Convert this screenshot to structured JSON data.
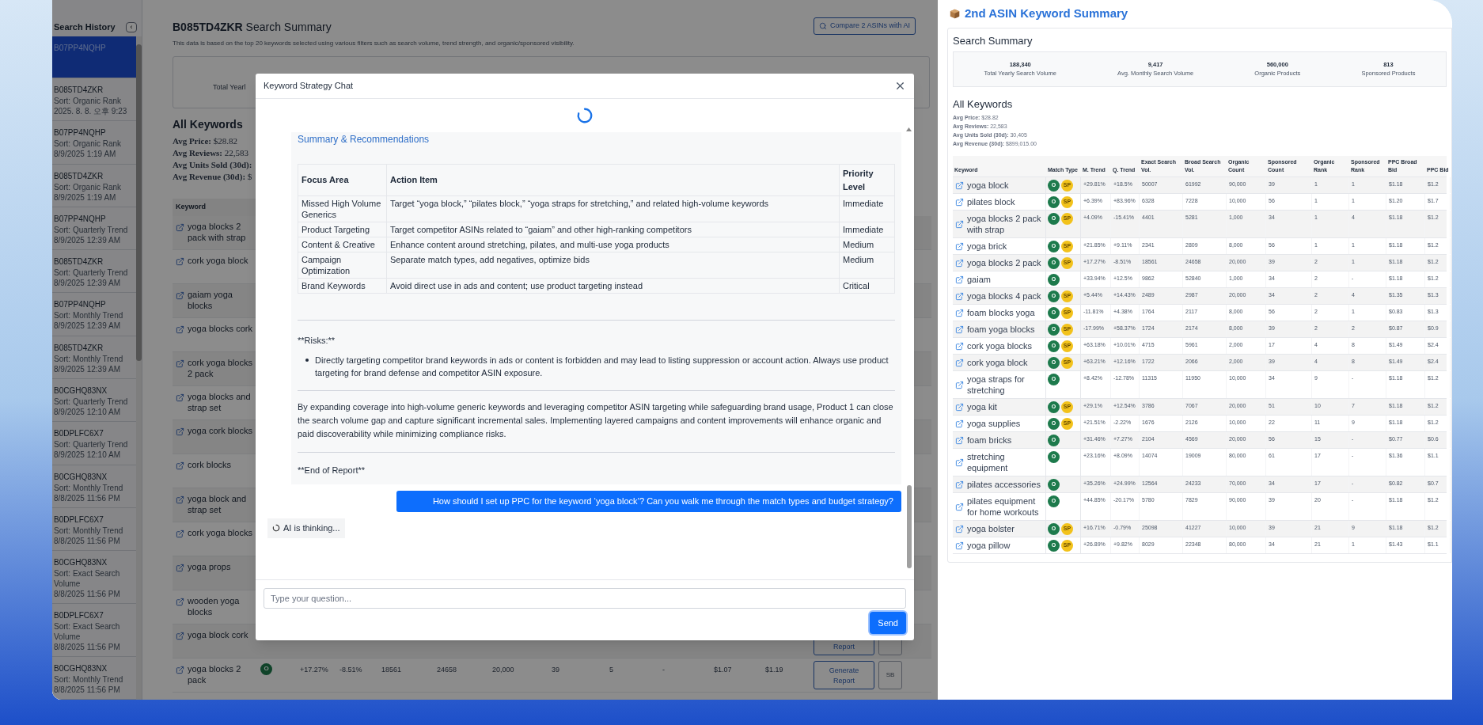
{
  "sidebar": {
    "title": "Search History",
    "collapse_label": "‹",
    "items": [
      {
        "asin": "B07PP4NQHP",
        "selected": true
      },
      {
        "asin": "B085TD4ZKR",
        "sort": "Sort: Organic Rank",
        "time": "2025. 8. 8. 오후 9:23",
        "selected": false
      },
      {
        "asin": "B07PP4NQHP",
        "sort": "Sort: Organic Rank",
        "time": "8/9/2025 1:19 AM",
        "selected": false
      },
      {
        "asin": "B085TD4ZKR",
        "sort": "Sort: Organic Rank",
        "time": "8/9/2025 1:19 AM",
        "selected": false
      },
      {
        "asin": "B07PP4NQHP",
        "sort": "Sort: Quarterly Trend",
        "time": "8/9/2025 12:39 AM",
        "selected": false
      },
      {
        "asin": "B085TD4ZKR",
        "sort": "Sort: Quarterly Trend",
        "time": "8/9/2025 12:39 AM",
        "selected": false
      },
      {
        "asin": "B07PP4NQHP",
        "sort": "Sort: Monthly Trend",
        "time": "8/9/2025 12:39 AM",
        "selected": false
      },
      {
        "asin": "B085TD4ZKR",
        "sort": "Sort: Monthly Trend",
        "time": "8/9/2025 12:39 AM",
        "selected": false
      },
      {
        "asin": "B0CGHQ83NX",
        "sort": "Sort: Quarterly Trend",
        "time": "8/9/2025 12:10 AM",
        "selected": false
      },
      {
        "asin": "B0DPLFC6X7",
        "sort": "Sort: Quarterly Trend",
        "time": "8/9/2025 12:10 AM",
        "selected": false
      },
      {
        "asin": "B0CGHQ83NX",
        "sort": "Sort: Monthly Trend",
        "time": "8/8/2025 11:56 PM",
        "selected": false
      },
      {
        "asin": "B0DPLFC6X7",
        "sort": "Sort: Monthly Trend",
        "time": "8/8/2025 11:56 PM",
        "selected": false
      },
      {
        "asin": "B0CGHQ83NX",
        "sort": "Sort: Exact Search Volume",
        "time": "8/8/2025 11:56 PM",
        "selected": false
      },
      {
        "asin": "B0DPLFC6X7",
        "sort": "Sort: Exact Search Volume",
        "time": "8/8/2025 11:56 PM",
        "selected": false
      },
      {
        "asin": "B0CGHQ83NX",
        "sort": "Sort: Monthly Trend",
        "time": "8/8/2025 11:56 PM",
        "selected": false
      }
    ]
  },
  "summary": {
    "title": "**B085TD4ZKR** Search Summary",
    "description": "This data is based on the top 20 keywords selected using various filters such as search volume, trend strength, and organic/sponsored visibility.",
    "compare_button": "Compare 2 ASINs with AI",
    "stat_label": "Total Yearl",
    "keywords_title": "All Keywords",
    "averages": [
      "**Avg Price:** $28.82",
      "**Avg Reviews:** 22,583",
      "**Avg Units Sold (30d):**",
      "**Avg Revenue (30d):** $"
    ],
    "table": {
      "column_1": "Keyword",
      "rows": [
        {
          "keyword": "yoga blocks 2 pack with strap"
        },
        {
          "keyword": "cork yoga block"
        },
        {
          "keyword": "gaiam yoga blocks"
        },
        {
          "keyword": "yoga blocks cork"
        },
        {
          "keyword": "cork yoga blocks 2 pack"
        },
        {
          "keyword": "yoga blocks and strap set"
        },
        {
          "keyword": "yoga cork blocks"
        },
        {
          "keyword": "cork blocks"
        },
        {
          "keyword": "yoga block and strap set"
        },
        {
          "keyword": "cork yoga blocks"
        },
        {
          "keyword": "yoga props"
        },
        {
          "keyword": "wooden yoga blocks"
        },
        {
          "keyword": "yoga block cork",
          "actions": [
            {
              "kind": "report",
              "label": "Report"
            },
            {
              "kind": "sb"
            }
          ]
        },
        {
          "keyword": "yoga blocks 2 pack",
          "match": [
            {
              "kind": "organic",
              "label": "O"
            }
          ],
          "cells": [
            "+17.27%",
            "-8.51%",
            "18561",
            "24658",
            "20,000",
            "39",
            "5",
            "-",
            "$1.07",
            "$1.19"
          ],
          "actions": [
            {
              "kind": "report",
              "label": "Generate Report"
            },
            {
              "kind": "sb",
              "label": "SB"
            }
          ]
        }
      ]
    }
  },
  "chat": {
    "title": "Keyword Strategy Chat",
    "loading": true,
    "ai_message": {
      "heading": "Summary & Recommendations",
      "table": {
        "columns": [
          "Focus Area",
          "Action Item",
          "Priority Level"
        ],
        "rows": [
          [
            "Missed High Volume Generics",
            "Target “yoga block,” “pilates block,” “yoga straps for stretching,” and related high-volume keywords",
            "Immediate"
          ],
          [
            "Product Targeting",
            "Target competitor ASINs related to “gaiam” and other high-ranking competitors",
            "Immediate"
          ],
          [
            "Content & Creative",
            "Enhance content around stretching, pilates, and multi-use yoga products",
            "Medium"
          ],
          [
            "Campaign Optimization",
            "Separate match types, add negatives, optimize bids",
            "Medium"
          ],
          [
            "Brand Keywords",
            "Avoid direct use in ads and content; use product targeting instead",
            "Critical"
          ]
        ]
      },
      "risks_label": "**Risks:**",
      "risks": [
        "Directly targeting competitor brand keywords in ads or content is forbidden and may lead to listing suppression or account action. Always use product targeting for brand defense and competitor ASIN exposure."
      ],
      "conclusion": "By expanding coverage into high-volume generic keywords and leveraging competitor ASIN targeting while safeguarding brand usage, Product 1 can close the search volume gap and capture significant incremental sales. Implementing layered campaigns and content improvements will enhance organic and paid discoverability while minimizing compliance risks.",
      "end": "**End of Report**"
    },
    "user_message": "How should I set up PPC for the keyword ‘yoga block’? Can you walk me through the match types and budget strategy?",
    "thinking": "AI is thinking...",
    "input_placeholder": "Type your question...",
    "send": "Send"
  },
  "second": {
    "title": "2nd ASIN Keyword Summary",
    "summary_title": "Search Summary",
    "stats": [
      {
        "value": "188,340",
        "label": "Total Yearly Search Volume"
      },
      {
        "value": "9,417",
        "label": "Avg. Monthly Search Volume"
      },
      {
        "value": "560,000",
        "label": "Organic Products"
      },
      {
        "value": "813",
        "label": "Sponsored Products"
      }
    ],
    "keywords_title": "All Keywords",
    "averages": [
      "**Avg Price:** $28.82",
      "**Avg Reviews:** 22,583",
      "**Avg Units Sold (30d):** 30,405",
      "**Avg Revenue (30d):** $899,015.00"
    ],
    "columns": [
      "Keyword",
      "Match Type",
      "M. Trend",
      "Q. Trend",
      "Exact Search Vol.",
      "Broad Search Vol.",
      "Organic Count",
      "Sponsored Count",
      "Organic Rank",
      "Sponsored Rank",
      "PPC Broad Bid",
      "PPC Bid"
    ],
    "rows": [
      {
        "keyword": "yoga block",
        "match_type": [
          {
            "kind": "organic",
            "label": "O"
          },
          {
            "kind": "sponsored",
            "label": "SP"
          }
        ],
        "m_trend": "+29.81%",
        "q_trend": "+18.5%",
        "exact_search_vol": "50007",
        "broad_search_vol": "61992",
        "organic_count": "90,000",
        "sponsored_count": "39",
        "organic_rank": "1",
        "sponsored_rank": "1",
        "ppc_broad_bid": "$1.18",
        "column_12": "$1.2"
      },
      {
        "keyword": "pilates block",
        "match_type": [
          {
            "kind": "organic",
            "label": "O"
          },
          {
            "kind": "sponsored",
            "label": "SP"
          }
        ],
        "m_trend": "+6.39%",
        "q_trend": "+83.96%",
        "exact_search_vol": "6328",
        "broad_search_vol": "7228",
        "organic_count": "10,000",
        "sponsored_count": "56",
        "organic_rank": "1",
        "sponsored_rank": "1",
        "ppc_broad_bid": "$1.20",
        "column_12": "$1.7"
      },
      {
        "keyword": "yoga blocks 2 pack with strap",
        "match_type": [
          {
            "kind": "organic",
            "label": "O"
          },
          {
            "kind": "sponsored",
            "label": "SP"
          }
        ],
        "m_trend": "+4.09%",
        "q_trend": "-15.41%",
        "exact_search_vol": "4401",
        "broad_search_vol": "5281",
        "organic_count": "1,000",
        "sponsored_count": "34",
        "organic_rank": "1",
        "sponsored_rank": "4",
        "ppc_broad_bid": "$1.18",
        "column_12": "$1.2"
      },
      {
        "keyword": "yoga brick",
        "match_type": [
          {
            "kind": "organic",
            "label": "O"
          },
          {
            "kind": "sponsored",
            "label": "SP"
          }
        ],
        "m_trend": "+21.85%",
        "q_trend": "+9.11%",
        "exact_search_vol": "2341",
        "broad_search_vol": "2809",
        "organic_count": "8,000",
        "sponsored_count": "56",
        "organic_rank": "1",
        "sponsored_rank": "1",
        "ppc_broad_bid": "$1.18",
        "column_12": "$1.2"
      },
      {
        "keyword": "yoga blocks 2 pack",
        "match_type": [
          {
            "kind": "organic",
            "label": "O"
          },
          {
            "kind": "sponsored",
            "label": "SP"
          }
        ],
        "m_trend": "+17.27%",
        "q_trend": "-8.51%",
        "exact_search_vol": "18561",
        "broad_search_vol": "24658",
        "organic_count": "20,000",
        "sponsored_count": "39",
        "organic_rank": "2",
        "sponsored_rank": "1",
        "ppc_broad_bid": "$1.18",
        "column_12": "$1.2"
      },
      {
        "keyword": "gaiam",
        "match_type": [
          {
            "kind": "organic",
            "label": "O"
          }
        ],
        "m_trend": "+33.94%",
        "q_trend": "+12.5%",
        "exact_search_vol": "9862",
        "broad_search_vol": "52840",
        "organic_count": "1,000",
        "sponsored_count": "34",
        "organic_rank": "2",
        "sponsored_rank": "-",
        "ppc_broad_bid": "$1.18",
        "column_12": "$1.2"
      },
      {
        "keyword": "yoga blocks 4 pack",
        "match_type": [
          {
            "kind": "organic",
            "label": "O"
          },
          {
            "kind": "sponsored",
            "label": "SP"
          }
        ],
        "m_trend": "+5.44%",
        "q_trend": "+14.43%",
        "exact_search_vol": "2489",
        "broad_search_vol": "2987",
        "organic_count": "20,000",
        "sponsored_count": "34",
        "organic_rank": "2",
        "sponsored_rank": "4",
        "ppc_broad_bid": "$1.35",
        "column_12": "$1.3"
      },
      {
        "keyword": "foam blocks yoga",
        "match_type": [
          {
            "kind": "organic",
            "label": "O"
          },
          {
            "kind": "sponsored",
            "label": "SP"
          }
        ],
        "m_trend": "-11.81%",
        "q_trend": "+4.38%",
        "exact_search_vol": "1764",
        "broad_search_vol": "2117",
        "organic_count": "8,000",
        "sponsored_count": "56",
        "organic_rank": "2",
        "sponsored_rank": "1",
        "ppc_broad_bid": "$0.83",
        "column_12": "$1.3"
      },
      {
        "keyword": "foam yoga blocks",
        "match_type": [
          {
            "kind": "organic",
            "label": "O"
          },
          {
            "kind": "sponsored",
            "label": "SP"
          }
        ],
        "m_trend": "-17.99%",
        "q_trend": "+58.37%",
        "exact_search_vol": "1724",
        "broad_search_vol": "2174",
        "organic_count": "8,000",
        "sponsored_count": "39",
        "organic_rank": "2",
        "sponsored_rank": "2",
        "ppc_broad_bid": "$0.87",
        "column_12": "$0.9"
      },
      {
        "keyword": "cork yoga blocks",
        "match_type": [
          {
            "kind": "organic",
            "label": "O"
          },
          {
            "kind": "sponsored",
            "label": "SP"
          }
        ],
        "m_trend": "+63.18%",
        "q_trend": "+10.01%",
        "exact_search_vol": "4715",
        "broad_search_vol": "5961",
        "organic_count": "2,000",
        "sponsored_count": "17",
        "organic_rank": "4",
        "sponsored_rank": "8",
        "ppc_broad_bid": "$1.49",
        "column_12": "$2.4"
      },
      {
        "keyword": "cork yoga block",
        "match_type": [
          {
            "kind": "organic",
            "label": "O"
          },
          {
            "kind": "sponsored",
            "label": "SP"
          }
        ],
        "m_trend": "+63.21%",
        "q_trend": "+12.16%",
        "exact_search_vol": "1722",
        "broad_search_vol": "2066",
        "organic_count": "2,000",
        "sponsored_count": "39",
        "organic_rank": "4",
        "sponsored_rank": "8",
        "ppc_broad_bid": "$1.49",
        "column_12": "$2.4"
      },
      {
        "keyword": "yoga straps for stretching",
        "match_type": [
          {
            "kind": "organic",
            "label": "O"
          }
        ],
        "m_trend": "+8.42%",
        "q_trend": "-12.78%",
        "exact_search_vol": "11315",
        "broad_search_vol": "11950",
        "organic_count": "10,000",
        "sponsored_count": "34",
        "organic_rank": "9",
        "sponsored_rank": "-",
        "ppc_broad_bid": "$1.18",
        "column_12": "$1.2"
      },
      {
        "keyword": "yoga kit",
        "match_type": [
          {
            "kind": "organic",
            "label": "O"
          },
          {
            "kind": "sponsored",
            "label": "SP"
          }
        ],
        "m_trend": "+29.1%",
        "q_trend": "+12.54%",
        "exact_search_vol": "3786",
        "broad_search_vol": "7067",
        "organic_count": "20,000",
        "sponsored_count": "51",
        "organic_rank": "10",
        "sponsored_rank": "7",
        "ppc_broad_bid": "$1.18",
        "column_12": "$1.2"
      },
      {
        "keyword": "yoga supplies",
        "match_type": [
          {
            "kind": "organic",
            "label": "O"
          },
          {
            "kind": "sponsored",
            "label": "SP"
          }
        ],
        "m_trend": "+21.51%",
        "q_trend": "-2.22%",
        "exact_search_vol": "1676",
        "broad_search_vol": "2126",
        "organic_count": "10,000",
        "sponsored_count": "22",
        "organic_rank": "11",
        "sponsored_rank": "9",
        "ppc_broad_bid": "$1.18",
        "column_12": "$1.2"
      },
      {
        "keyword": "foam bricks",
        "match_type": [
          {
            "kind": "organic",
            "label": "O"
          }
        ],
        "m_trend": "+31.46%",
        "q_trend": "+7.27%",
        "exact_search_vol": "2104",
        "broad_search_vol": "4569",
        "organic_count": "20,000",
        "sponsored_count": "56",
        "organic_rank": "15",
        "sponsored_rank": "-",
        "ppc_broad_bid": "$0.77",
        "column_12": "$0.6"
      },
      {
        "keyword": "stretching equipment",
        "match_type": [
          {
            "kind": "organic",
            "label": "O"
          }
        ],
        "m_trend": "+23.16%",
        "q_trend": "+8.09%",
        "exact_search_vol": "14074",
        "broad_search_vol": "19009",
        "organic_count": "80,000",
        "sponsored_count": "61",
        "organic_rank": "17",
        "sponsored_rank": "-",
        "ppc_broad_bid": "$1.36",
        "column_12": "$1.1"
      },
      {
        "keyword": "pilates accessories",
        "match_type": [
          {
            "kind": "organic",
            "label": "O"
          }
        ],
        "m_trend": "+35.26%",
        "q_trend": "+24.99%",
        "exact_search_vol": "12564",
        "broad_search_vol": "24233",
        "organic_count": "70,000",
        "sponsored_count": "34",
        "organic_rank": "17",
        "sponsored_rank": "-",
        "ppc_broad_bid": "$0.82",
        "column_12": "$0.7"
      },
      {
        "keyword": "pilates equipment for home workouts",
        "match_type": [
          {
            "kind": "organic",
            "label": "O"
          }
        ],
        "m_trend": "+44.85%",
        "q_trend": "-20.17%",
        "exact_search_vol": "5780",
        "broad_search_vol": "7829",
        "organic_count": "90,000",
        "sponsored_count": "39",
        "organic_rank": "20",
        "sponsored_rank": "-",
        "ppc_broad_bid": "$1.18",
        "column_12": "$1.2"
      },
      {
        "keyword": "yoga bolster",
        "match_type": [
          {
            "kind": "organic",
            "label": "O"
          },
          {
            "kind": "sponsored",
            "label": "SP"
          }
        ],
        "m_trend": "+16.71%",
        "q_trend": "-0.79%",
        "exact_search_vol": "25098",
        "broad_search_vol": "41227",
        "organic_count": "10,000",
        "sponsored_count": "39",
        "organic_rank": "21",
        "sponsored_rank": "9",
        "ppc_broad_bid": "$1.18",
        "column_12": "$1.2"
      },
      {
        "keyword": "yoga pillow",
        "match_type": [
          {
            "kind": "organic",
            "label": "O"
          },
          {
            "kind": "sponsored",
            "label": "SP"
          }
        ],
        "m_trend": "+26.89%",
        "q_trend": "+9.82%",
        "exact_search_vol": "8029",
        "broad_search_vol": "22348",
        "organic_count": "80,000",
        "sponsored_count": "34",
        "organic_rank": "21",
        "sponsored_rank": "1",
        "ppc_broad_bid": "$1.43",
        "column_12": "$1.1"
      }
    ]
  }
}
